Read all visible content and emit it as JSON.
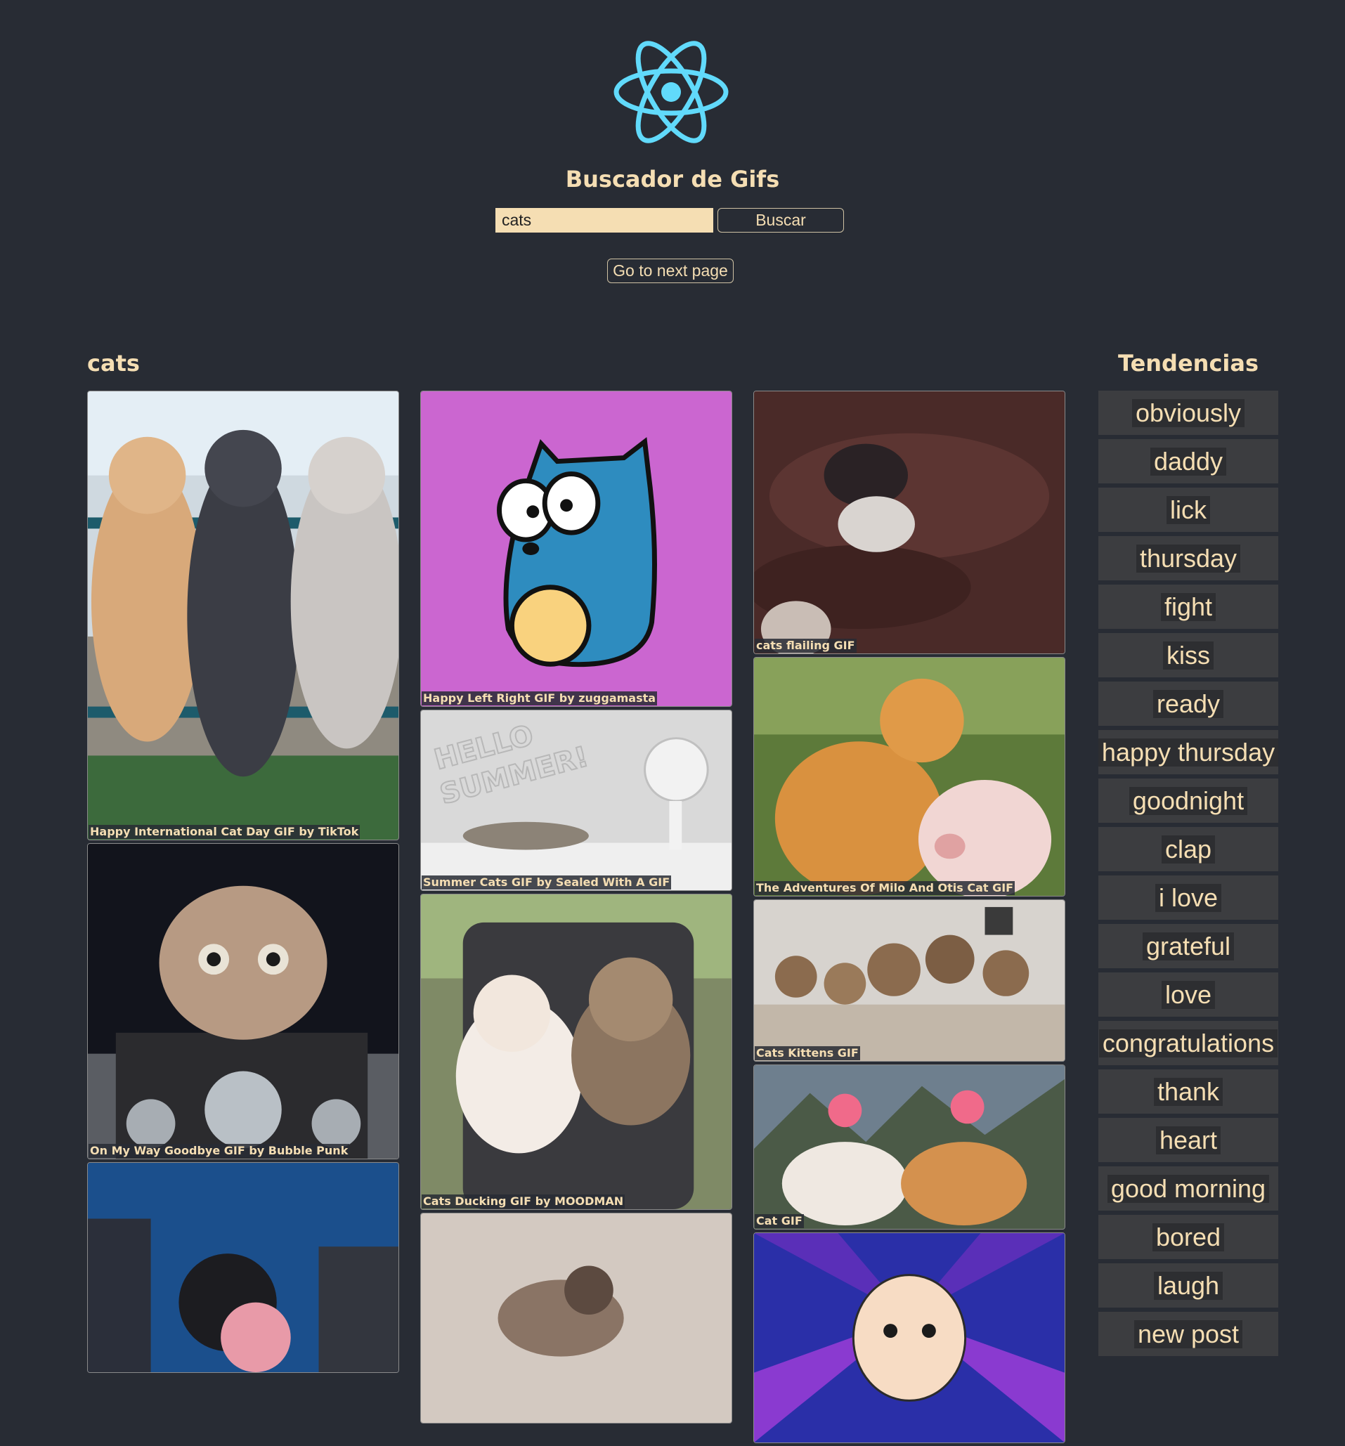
{
  "header": {
    "logo_icon": "react-logo-icon",
    "title": "Buscador de Gifs",
    "search": {
      "value": "cats",
      "button_label": "Buscar"
    },
    "next_page_label": "Go to next page",
    "accent_color": "#61dafb"
  },
  "results": {
    "query": "cats",
    "gifs": [
      {
        "title": "Happy International Cat Day GIF by TikTok"
      },
      {
        "title": "On My Way Goodbye GIF by Bubble Punk"
      },
      {
        "title": ""
      },
      {
        "title": "Happy Left Right GIF by zuggamasta"
      },
      {
        "title": "Summer Cats GIF by Sealed With A GIF"
      },
      {
        "title": "Cats Ducking GIF by MOODMAN"
      },
      {
        "title": ""
      },
      {
        "title": "cats flailing GIF"
      },
      {
        "title": "The Adventures Of Milo And Otis Cat GIF"
      },
      {
        "title": "Cats Kittens GIF"
      },
      {
        "title": "Cat GIF"
      },
      {
        "title": ""
      }
    ]
  },
  "trends": {
    "title": "Tendencias",
    "items": [
      "obviously",
      "daddy",
      "lick",
      "thursday",
      "fight",
      "kiss",
      "ready",
      "happy thursday",
      "goodnight",
      "clap",
      "i love",
      "grateful",
      "love",
      "congratulations",
      "thank",
      "heart",
      "good morning",
      "bored",
      "laugh",
      "new post"
    ]
  }
}
